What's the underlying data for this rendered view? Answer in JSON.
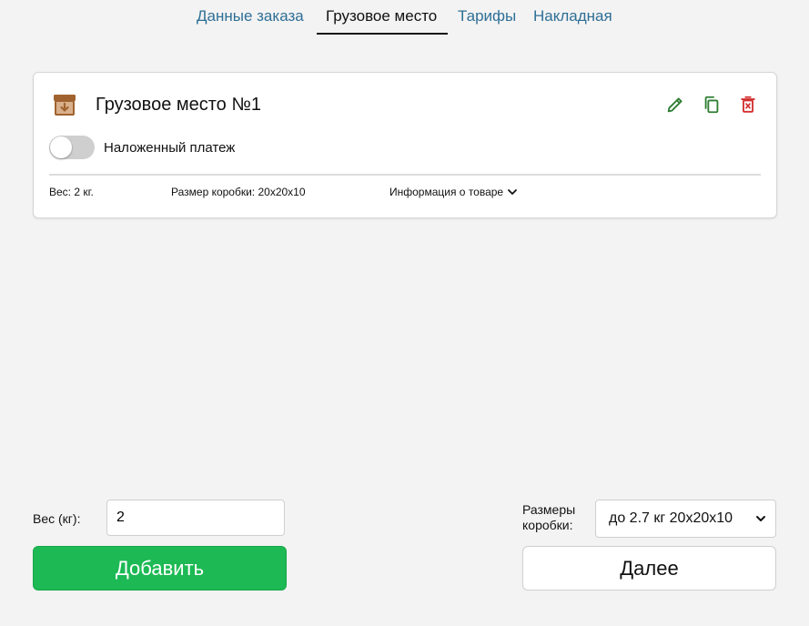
{
  "tabs": [
    {
      "label": "Данные заказа",
      "active": false
    },
    {
      "label": "Грузовое место",
      "active": true
    },
    {
      "label": "Тарифы",
      "active": false
    },
    {
      "label": "Накладная",
      "active": false
    }
  ],
  "card": {
    "title": "Грузовое место №1",
    "cod_label": "Наложенный платеж",
    "cod_enabled": false,
    "weight_info": "Вес: 2 кг.",
    "box_info": "Размер коробки: 20x20x10",
    "product_info": "Информация о товаре",
    "icons": {
      "edit": "pencil-icon",
      "copy": "copy-icon",
      "delete": "trash-icon",
      "box": "archive-box-icon"
    },
    "colors": {
      "edit": "#2e7d32",
      "copy": "#2e7d32",
      "delete": "#d32f2f",
      "box": "#a0632f"
    }
  },
  "form": {
    "weight_label": "Вес (кг):",
    "weight_value": "2",
    "add_label": "Добавить",
    "box_label_line1": "Размеры",
    "box_label_line2": "коробки:",
    "box_selected": "до 2.7 кг 20x20x10",
    "next_label": "Далее"
  },
  "colors": {
    "accent": "#1db954",
    "tab_link": "#2e6f96"
  }
}
